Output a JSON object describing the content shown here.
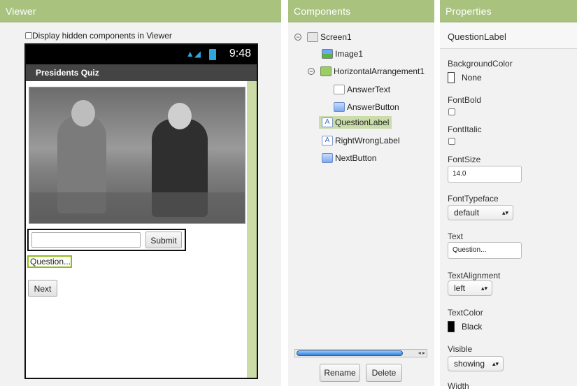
{
  "viewer": {
    "header": "Viewer",
    "hidden_components_label": "Display hidden components in Viewer",
    "status_time": "9:48",
    "app_title": "Presidents Quiz",
    "submit_label": "Submit",
    "question_text": "Question...",
    "next_label": "Next"
  },
  "components": {
    "header": "Components",
    "tree": [
      {
        "label": "Screen1"
      },
      {
        "label": "Image1"
      },
      {
        "label": "HorizontalArrangement1"
      },
      {
        "label": "AnswerText"
      },
      {
        "label": "AnswerButton"
      },
      {
        "label": "QuestionLabel"
      },
      {
        "label": "RightWrongLabel"
      },
      {
        "label": "NextButton"
      }
    ],
    "rename_label": "Rename",
    "delete_label": "Delete"
  },
  "properties": {
    "header": "Properties",
    "selected_component": "QuestionLabel",
    "background_color": {
      "name": "BackgroundColor",
      "value": "None",
      "swatch": "#ffffff"
    },
    "font_bold": {
      "name": "FontBold",
      "checked": false
    },
    "font_italic": {
      "name": "FontItalic",
      "checked": false
    },
    "font_size": {
      "name": "FontSize",
      "value": "14.0"
    },
    "font_typeface": {
      "name": "FontTypeface",
      "value": "default"
    },
    "text": {
      "name": "Text",
      "value": "Question..."
    },
    "text_alignment": {
      "name": "TextAlignment",
      "value": "left"
    },
    "text_color": {
      "name": "TextColor",
      "value": "Black",
      "swatch": "#000000"
    },
    "visible": {
      "name": "Visible",
      "value": "showing"
    },
    "width": {
      "name": "Width"
    }
  },
  "colors": {
    "header_green": "#a9c37f",
    "selection_green": "#c9dcaa",
    "label_border": "#8fbc1a"
  }
}
